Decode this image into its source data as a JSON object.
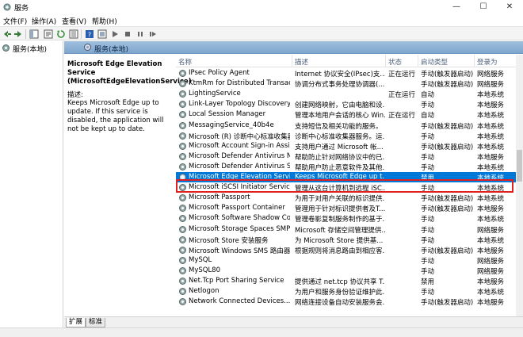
{
  "window": {
    "title": "服务",
    "controls": {
      "minimize": "—",
      "maximize": "☐",
      "close": "✕"
    }
  },
  "menu": [
    "文件(F)",
    "操作(A)",
    "查看(V)",
    "帮助(H)"
  ],
  "tree": {
    "root_label": "服务(本地)"
  },
  "content": {
    "header_label": "服务(本地)"
  },
  "details": {
    "service_name": "Microsoft Edge Elevation Service (MicrosoftEdgeElevationService)",
    "desc_label": "描述:",
    "desc_text": "Keeps Microsoft Edge up to update. If this service is disabled, the application will not be kept up to date."
  },
  "table": {
    "columns": {
      "name": "名称",
      "desc": "描述",
      "status": "状态",
      "start": "启动类型",
      "logon": "登录为"
    },
    "rows": [
      {
        "name": "IPsec Policy Agent",
        "desc": "Internet 协议安全(IPsec)支...",
        "status": "正在运行",
        "start": "手动(触发器启动)",
        "logon": "网络服务"
      },
      {
        "name": "KtmRm for Distributed Transacti...",
        "desc": "协调分布式事务处理协调器(...",
        "status": "",
        "start": "手动(触发器启动)",
        "logon": "网络服务"
      },
      {
        "name": "LightingService",
        "desc": "",
        "status": "正在运行",
        "start": "自动",
        "logon": "本地系统"
      },
      {
        "name": "Link-Layer Topology Discovery ...",
        "desc": "创建网络映射，它由电脑和设...",
        "status": "",
        "start": "手动",
        "logon": "本地服务"
      },
      {
        "name": "Local Session Manager",
        "desc": "管理本地用户会话的核心 Win...",
        "status": "正在运行",
        "start": "自动",
        "logon": "本地系统"
      },
      {
        "name": "MessagingService_40b4e",
        "desc": "支持短信及相关功能的服务。",
        "status": "",
        "start": "手动(触发器启动)",
        "logon": "本地系统"
      },
      {
        "name": "Microsoft (R) 诊断中心标准收集器...",
        "desc": "诊断中心标准收集器服务。运...",
        "status": "",
        "start": "手动",
        "logon": "本地系统"
      },
      {
        "name": "Microsoft Account Sign-in Assist...",
        "desc": "支持用户通过 Microsoft 帐...",
        "status": "",
        "start": "手动(触发器启动)",
        "logon": "本地系统"
      },
      {
        "name": "Microsoft Defender Antivirus Ne...",
        "desc": "帮助防止针对网络协议中的已...",
        "status": "",
        "start": "手动",
        "logon": "本地服务"
      },
      {
        "name": "Microsoft Defender Antivirus Se...",
        "desc": "帮助用户防止恶意软件及其他...",
        "status": "",
        "start": "手动",
        "logon": "本地系统"
      },
      {
        "name": "Microsoft Edge Elevation Servic...",
        "desc": "Keeps Microsoft Edge up t...",
        "status": "",
        "start": "禁用",
        "logon": "本地系统",
        "selected": true
      },
      {
        "name": "Microsoft iSCSI Initiator Service",
        "desc": "管理从这台计算机到远程 iSC...",
        "status": "",
        "start": "手动",
        "logon": "本地系统"
      },
      {
        "name": "Microsoft Passport",
        "desc": "为用于对用户关联的标识提供...",
        "status": "",
        "start": "手动(触发器启动)",
        "logon": "本地系统"
      },
      {
        "name": "Microsoft Passport Container",
        "desc": "管理用于针对标识提供者及T...",
        "status": "",
        "start": "手动(触发器启动)",
        "logon": "本地服务"
      },
      {
        "name": "Microsoft Software Shadow Cop...",
        "desc": "管理卷影复制服务制作的基于...",
        "status": "",
        "start": "手动",
        "logon": "本地系统"
      },
      {
        "name": "Microsoft Storage Spaces SMP",
        "desc": "Microsoft 存储空间管理提供...",
        "status": "",
        "start": "手动",
        "logon": "网络服务"
      },
      {
        "name": "Microsoft Store 安装服务",
        "desc": "为 Microsoft Store 提供基...",
        "status": "",
        "start": "手动",
        "logon": "本地系统"
      },
      {
        "name": "Microsoft Windows SMS 路由器...",
        "desc": "根据规则将消息路由到相应客...",
        "status": "",
        "start": "手动(触发器启动)",
        "logon": "本地服务"
      },
      {
        "name": "MySQL",
        "desc": "",
        "status": "",
        "start": "手动",
        "logon": "网络服务"
      },
      {
        "name": "MySQL80",
        "desc": "",
        "status": "",
        "start": "手动",
        "logon": "网络服务"
      },
      {
        "name": "Net.Tcp Port Sharing Service",
        "desc": "提供通过 net.tcp 协议共享 T...",
        "status": "",
        "start": "禁用",
        "logon": "本地服务"
      },
      {
        "name": "Netlogon",
        "desc": "为用户和服务身份验证维护此...",
        "status": "",
        "start": "手动",
        "logon": "本地系统"
      },
      {
        "name": "Network Connected Devices...",
        "desc": "网络连接设备自动安装服务会...",
        "status": "",
        "start": "手动(触发器启动)",
        "logon": "本地服务"
      }
    ]
  },
  "tabs": [
    "扩展",
    "标准"
  ],
  "colors": {
    "selection": "#0078d7",
    "highlight_outline": "#e02020",
    "header": "#8fb3d9"
  }
}
